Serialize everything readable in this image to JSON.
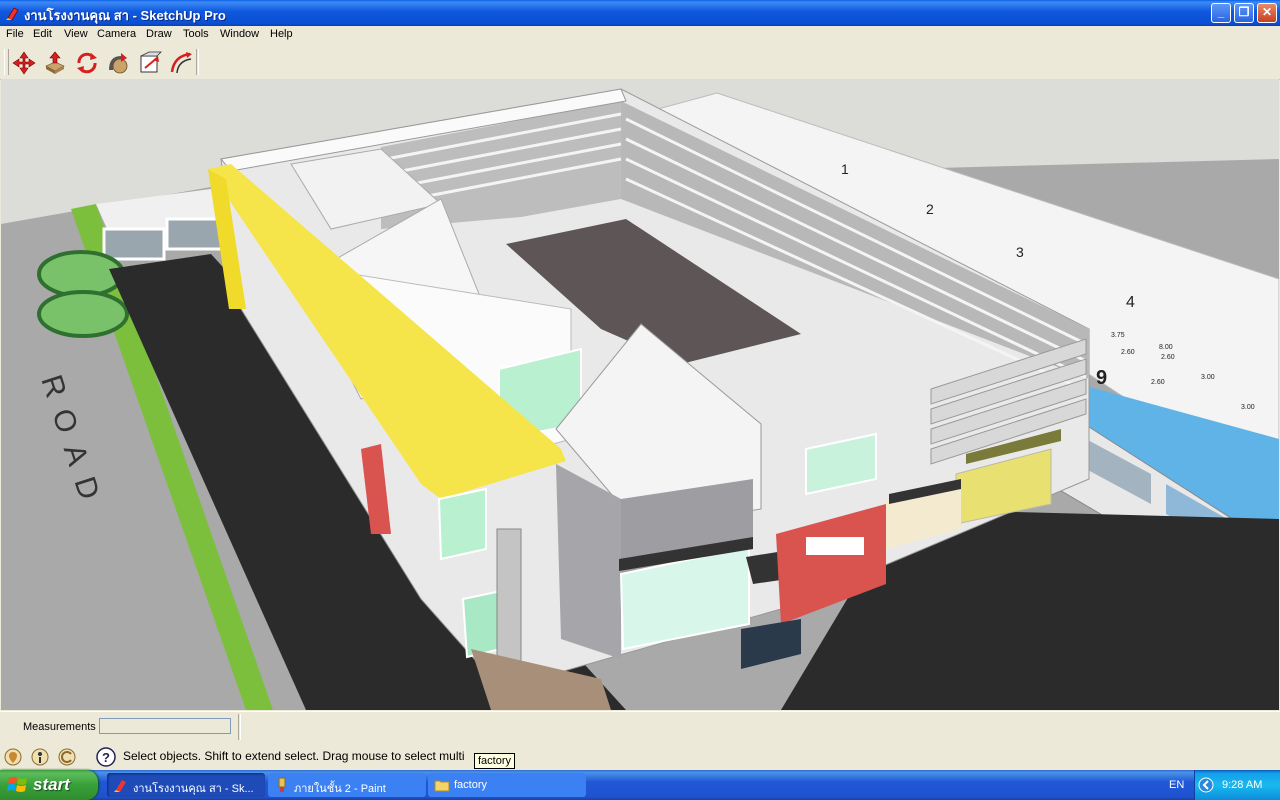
{
  "window": {
    "title": "งานโรงงานคุณ สา - SketchUp Pro",
    "min": "_",
    "max": "❐",
    "close": "✕"
  },
  "menu": {
    "items": [
      "File",
      "Edit",
      "View",
      "Camera",
      "Draw",
      "Tools",
      "Window",
      "Help"
    ]
  },
  "toolbar": {
    "icons": [
      "move-tool-icon",
      "push-pull-tool-icon",
      "rotate-tool-icon",
      "follow-me-tool-icon",
      "scale-tool-icon",
      "offset-tool-icon"
    ]
  },
  "scene": {
    "road_label": "ROAD",
    "grid_numbers": [
      "1",
      "2",
      "3",
      "4",
      "9"
    ],
    "dimensions": [
      "3.75",
      "2.60",
      "2.60",
      "3.00",
      "2.60",
      "3.00",
      "8.00"
    ],
    "colors": {
      "sky": "#dcdcd8",
      "ground": "#a8a8a8",
      "road": "#2a2a2a",
      "grass": "#78b83a",
      "yellow_band": "#f5e54a",
      "red_wall": "#d9534f",
      "water": "#5fb3e6",
      "floor_dark": "#5e5656"
    }
  },
  "measurements": {
    "label": "Measurements",
    "value": ""
  },
  "status": {
    "text": "Select objects. Shift to extend select. Drag mouse to select multi",
    "tooltip": "factory",
    "icons": [
      "geo-location-icon",
      "credits-icon",
      "sign-in-icon"
    ]
  },
  "taskbar": {
    "start_label": "start",
    "tasks": [
      "งานโรงงานคุณ สา - Sk...",
      "ภายในชั้น 2 - Paint",
      "factory"
    ],
    "language": "EN",
    "clock": "9:28 AM"
  }
}
